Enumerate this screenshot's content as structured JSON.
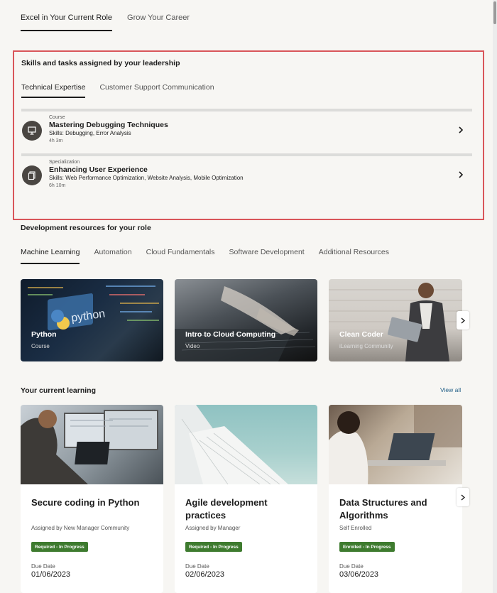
{
  "top_tabs": [
    {
      "label": "Excel in Your Current Role",
      "active": true
    },
    {
      "label": "Grow Your Career",
      "active": false
    }
  ],
  "leadership": {
    "title": "Skills and tasks assigned by your leadership",
    "tabs": [
      {
        "label": "Technical Expertise",
        "active": true
      },
      {
        "label": "Customer Support Communication",
        "active": false
      }
    ],
    "items": [
      {
        "kind": "Course",
        "title": "Mastering Debugging Techniques",
        "skills": "Skills: Debugging, Error Analysis",
        "duration": "4h 3m",
        "icon": "presentation-icon"
      },
      {
        "kind": "Specialization",
        "title": "Enhancing User Experience",
        "skills": "Skills: Web Performance Optimization, Website Analysis, Mobile Optimization",
        "duration": "6h 10m",
        "icon": "document-stack-icon"
      }
    ]
  },
  "development": {
    "title": "Development resources for your role",
    "tabs": [
      {
        "label": "Machine Learning",
        "active": true
      },
      {
        "label": "Automation",
        "active": false
      },
      {
        "label": "Cloud Fundamentals",
        "active": false
      },
      {
        "label": "Software Development",
        "active": false
      },
      {
        "label": "Additional Resources",
        "active": false
      }
    ],
    "cards": [
      {
        "title": "Python",
        "type": "Course"
      },
      {
        "title": "Intro to Cloud Computing",
        "type": "Video"
      },
      {
        "title": "Clean Coder",
        "type": "iLearning Community"
      }
    ]
  },
  "current_learning": {
    "title": "Your current learning",
    "view_all": "View all",
    "due_label": "Due Date",
    "cards": [
      {
        "title": "Secure coding in Python",
        "assigned": "Assigned by New Manager Community",
        "status": "Required - In Progress",
        "due": "01/06/2023"
      },
      {
        "title": "Agile development practices",
        "assigned": "Assigned by Manager",
        "status": "Required - In Progress",
        "due": "02/06/2023"
      },
      {
        "title": "Data Structures and Algorithms",
        "assigned": "Self Enrolled",
        "status": "Enrolled - In Progress",
        "due": "03/06/2023"
      }
    ]
  },
  "colors": {
    "accent": "#d9565a",
    "status_green": "#3e7b2f",
    "link": "#1f5d86",
    "page_bg": "#f7f6f3"
  }
}
